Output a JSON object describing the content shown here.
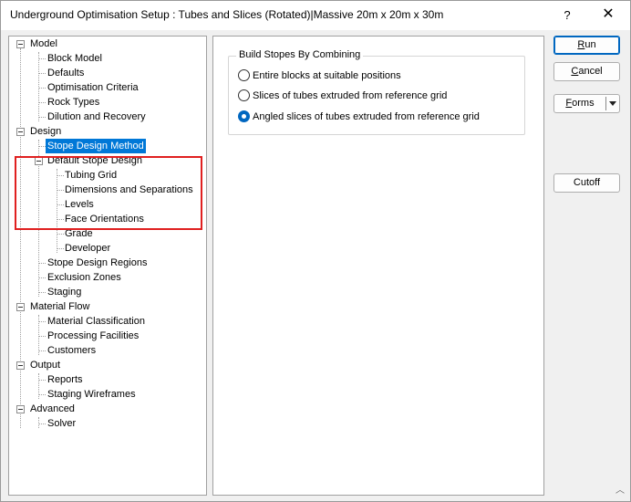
{
  "window": {
    "title": "Underground Optimisation Setup : Tubes and Slices (Rotated)|Massive 20m x 20m x 30m",
    "help_glyph": "?",
    "close_glyph": "✕",
    "icons": {
      "help": "help-icon",
      "close": "close-icon"
    }
  },
  "tree": {
    "items": [
      {
        "label": "Model"
      },
      {
        "label": "Block Model"
      },
      {
        "label": "Defaults"
      },
      {
        "label": "Optimisation Criteria"
      },
      {
        "label": "Rock Types"
      },
      {
        "label": "Dilution and Recovery"
      },
      {
        "label": "Design"
      },
      {
        "label": "Stope Design Method"
      },
      {
        "label": "Default Stope Design"
      },
      {
        "label": "Tubing Grid"
      },
      {
        "label": "Dimensions and Separations"
      },
      {
        "label": "Levels"
      },
      {
        "label": "Face Orientations"
      },
      {
        "label": "Grade"
      },
      {
        "label": "Developer"
      },
      {
        "label": "Stope Design Regions"
      },
      {
        "label": "Exclusion Zones"
      },
      {
        "label": "Staging"
      },
      {
        "label": "Material Flow"
      },
      {
        "label": "Material Classification"
      },
      {
        "label": "Processing Facilities"
      },
      {
        "label": "Customers"
      },
      {
        "label": "Output"
      },
      {
        "label": "Reports"
      },
      {
        "label": "Staging Wireframes"
      },
      {
        "label": "Advanced"
      },
      {
        "label": "Solver"
      }
    ],
    "selected": "Stope Design Method",
    "highlight_color": "#e02020",
    "selection_color": "#0078d7"
  },
  "main": {
    "group_title": "Build Stopes By Combining",
    "options": [
      {
        "label": "Entire blocks at suitable positions",
        "checked": false
      },
      {
        "label": "Slices of tubes extruded from reference grid",
        "checked": false
      },
      {
        "label": "Angled slices of tubes extruded from reference grid",
        "checked": true
      }
    ]
  },
  "buttons": {
    "run": {
      "mnemonic": "R",
      "rest": "un"
    },
    "cancel": {
      "mnemonic": "C",
      "rest": "ancel"
    },
    "forms": {
      "mnemonic": "F",
      "rest": "orms"
    },
    "cutoff": "Cutoff",
    "forms_dropdown_icon": "chevron-down-icon"
  },
  "resize_glyph": "︿"
}
